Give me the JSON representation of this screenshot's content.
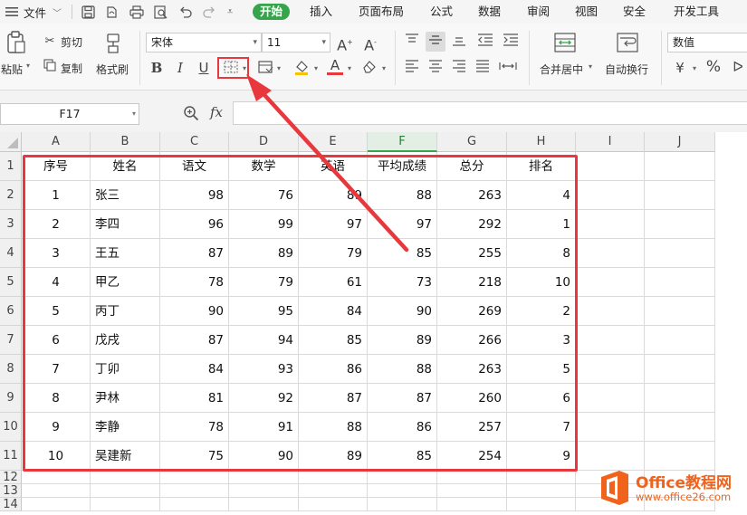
{
  "menubar": {
    "file_label": "文件",
    "tabs": [
      "开始",
      "插入",
      "页面布局",
      "公式",
      "数据",
      "审阅",
      "视图",
      "安全",
      "开发工具"
    ],
    "active_tab": "开始"
  },
  "ribbon": {
    "paste": "粘贴",
    "cut": "剪切",
    "copy": "复制",
    "format_painter": "格式刷",
    "font_name": "宋体",
    "font_size": "11",
    "merge_center": "合并居中",
    "wrap_text": "自动换行",
    "number_format": "数值"
  },
  "formula_bar": {
    "cell_ref": "F17",
    "fx_label": "fx"
  },
  "columns": [
    "A",
    "B",
    "C",
    "D",
    "E",
    "F",
    "G",
    "H",
    "I",
    "J"
  ],
  "rows": [
    "1",
    "2",
    "3",
    "4",
    "5",
    "6",
    "7",
    "8",
    "9",
    "10",
    "11",
    "12",
    "13",
    "14"
  ],
  "table": {
    "headers": [
      "序号",
      "姓名",
      "语文",
      "数学",
      "英语",
      "平均成绩",
      "总分",
      "排名"
    ],
    "rows": [
      [
        "1",
        "张三",
        "98",
        "76",
        "89",
        "88",
        "263",
        "4"
      ],
      [
        "2",
        "李四",
        "96",
        "99",
        "97",
        "97",
        "292",
        "1"
      ],
      [
        "3",
        "王五",
        "87",
        "89",
        "79",
        "85",
        "255",
        "8"
      ],
      [
        "4",
        "甲乙",
        "78",
        "79",
        "61",
        "73",
        "218",
        "10"
      ],
      [
        "5",
        "丙丁",
        "90",
        "95",
        "84",
        "90",
        "269",
        "2"
      ],
      [
        "6",
        "戊戌",
        "87",
        "94",
        "85",
        "89",
        "266",
        "3"
      ],
      [
        "7",
        "丁卯",
        "84",
        "93",
        "86",
        "88",
        "263",
        "5"
      ],
      [
        "8",
        "尹林",
        "81",
        "92",
        "87",
        "87",
        "260",
        "6"
      ],
      [
        "9",
        "李静",
        "78",
        "91",
        "88",
        "86",
        "257",
        "7"
      ],
      [
        "10",
        "吴建新",
        "75",
        "90",
        "89",
        "85",
        "254",
        "9"
      ]
    ]
  },
  "watermark": {
    "brand": "Office教程网",
    "url": "www.office26.com"
  },
  "colors": {
    "accent_green": "#35a44b",
    "highlight_red": "#e8383d",
    "logo_orange": "#f0631c"
  }
}
